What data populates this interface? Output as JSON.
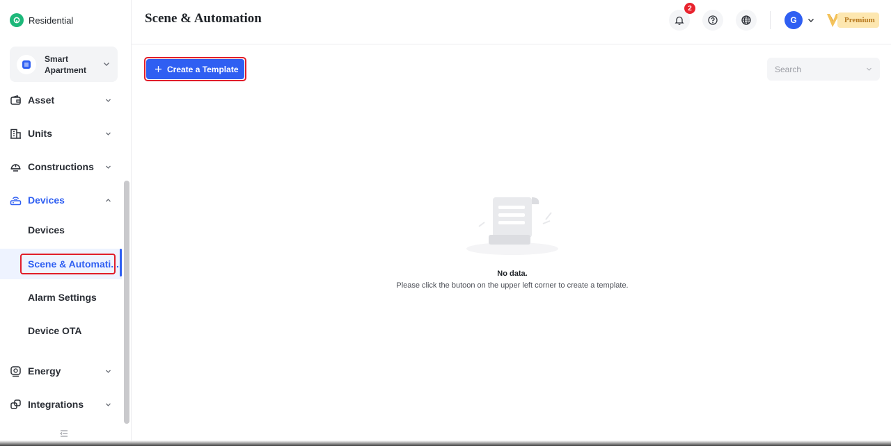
{
  "brand": {
    "name": "Residential",
    "color": "#1db87a"
  },
  "project": {
    "name": "Smart Apartment"
  },
  "nav": {
    "items": [
      {
        "label": "Asset",
        "icon": "wallet-icon"
      },
      {
        "label": "Units",
        "icon": "building-icon"
      },
      {
        "label": "Constructions",
        "icon": "helmet-icon"
      },
      {
        "label": "Devices",
        "icon": "router-icon",
        "open": true
      },
      {
        "label": "Energy",
        "icon": "energy-icon"
      },
      {
        "label": "Integrations",
        "icon": "integrations-icon"
      }
    ],
    "devices_sub": [
      "Devices",
      "Scene & Automati...",
      "Alarm Settings",
      "Device OTA"
    ]
  },
  "header": {
    "title": "Scene & Automation",
    "notification_count": "2",
    "avatar_initial": "G",
    "premium_label": "Premium"
  },
  "toolbar": {
    "create_label": "Create a Template",
    "search_placeholder": "Search"
  },
  "empty": {
    "title": "No data.",
    "description": "Please click the butoon on the upper left corner to create a template."
  },
  "colors": {
    "accent": "#2f5ff2",
    "highlight": "#e11d2a",
    "badge": "#e8232e",
    "premium": "#fde7b0"
  }
}
